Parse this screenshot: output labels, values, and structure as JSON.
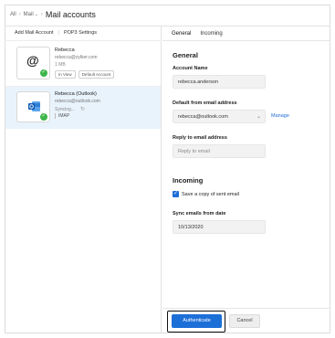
{
  "breadcrumb": {
    "items": [
      "All",
      "Mail"
    ],
    "current": "Mail accounts"
  },
  "toolbar": {
    "add_mail_account": "Add Mail Account",
    "pop3_settings": "POP3 Settings"
  },
  "accounts": [
    {
      "name": "Rebecca",
      "email": "rebecca@zylker.com",
      "meta": "1 MB",
      "chips": [
        "In View",
        "Default Account"
      ],
      "icon": "at-icon",
      "status": "connected",
      "selected": false
    },
    {
      "name": "Rebecca (Outlook)",
      "email": "rebecca@outlook.com",
      "meta": "Syncing...",
      "protocol": "IMAP",
      "icon": "outlook-icon",
      "status": "connected",
      "selected": true
    }
  ],
  "tabs": [
    {
      "label": "General",
      "active": true
    },
    {
      "label": "Incoming",
      "active": false
    }
  ],
  "general": {
    "section_title": "General",
    "account_name_label": "Account Name",
    "account_name_value": "rebecca.anderson",
    "default_from_label": "Default from email address",
    "default_from_value": "rebecca@outlook.com",
    "manage_link": "Manage",
    "reply_to_label": "Reply to email address",
    "reply_to_placeholder": "Reply to email"
  },
  "incoming": {
    "section_title": "Incoming",
    "save_copy_label": "Save a copy of sent email",
    "save_copy_checked": true,
    "sync_from_label": "Sync emails from date",
    "sync_from_value": "10/13/2020"
  },
  "footer": {
    "authenticate_label": "Authenticate",
    "cancel_label": "Cancel"
  },
  "colors": {
    "accent": "#1d6fd8",
    "success": "#3cb54a",
    "selected_row": "#e9f3fc"
  }
}
